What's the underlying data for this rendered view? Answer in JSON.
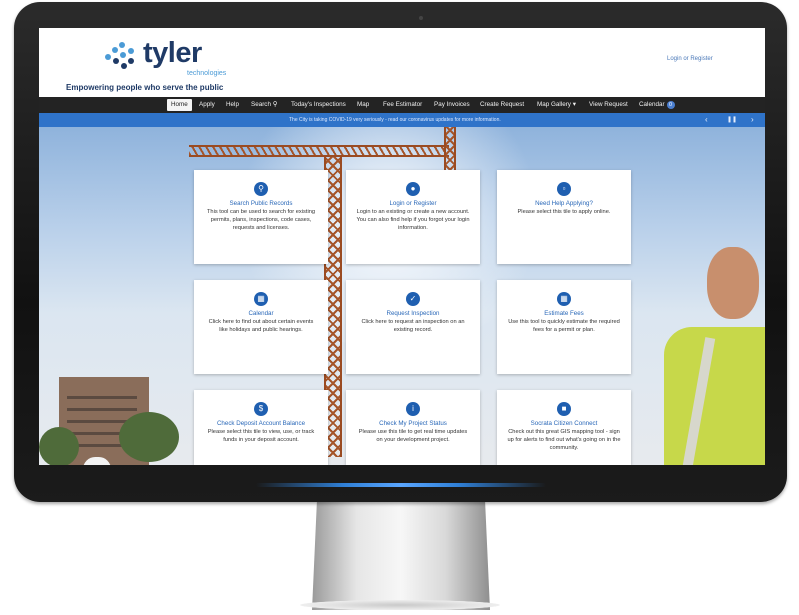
{
  "header": {
    "logo_text": "tyler",
    "logo_sub": "technologies",
    "tagline": "Empowering people who serve the public",
    "login_link": "Login or Register"
  },
  "nav": {
    "items": [
      {
        "label": "Home"
      },
      {
        "label": "Apply"
      },
      {
        "label": "Help"
      },
      {
        "label": "Search"
      },
      {
        "label": "Today's Inspections"
      },
      {
        "label": "Map"
      },
      {
        "label": "Fee Estimator"
      },
      {
        "label": "Pay Invoices"
      },
      {
        "label": "Create Request"
      },
      {
        "label": "Map Gallery"
      },
      {
        "label": "View Request"
      },
      {
        "label": "Calendar"
      }
    ],
    "search_icon": "search-icon",
    "dropdown_icon": "caret-down-icon",
    "calendar_badge": "0"
  },
  "alert": {
    "text": "The City is taking COVID-19 very seriously - read our coronavirus updates for more information.",
    "prev": "‹",
    "pause": "❚❚",
    "next": "›"
  },
  "tiles": [
    {
      "icon": "search-icon",
      "title": "Search Public Records",
      "desc": "This tool can be used to search for existing permits, plans, inspections, code cases, requests and licenses."
    },
    {
      "icon": "users-icon",
      "title": "Login or Register",
      "desc": "Login to an existing or create a new account. You can also find help if you forgot your login information."
    },
    {
      "icon": "clipboard-icon",
      "title": "Need Help Applying?",
      "desc": "Please select this tile to apply online."
    },
    {
      "icon": "calendar-icon",
      "title": "Calendar",
      "desc": "Click here to find out about certain events like holidays and public hearings."
    },
    {
      "icon": "calendar-check-icon",
      "title": "Request Inspection",
      "desc": "Click here to request an inspection on an existing record."
    },
    {
      "icon": "calculator-icon",
      "title": "Estimate Fees",
      "desc": "Use this tool to quickly estimate the required fees for a permit or plan."
    },
    {
      "icon": "dollar-icon",
      "title": "Check Deposit Account Balance",
      "desc": "Please select this tile to view, use, or track funds in your deposit account."
    },
    {
      "icon": "info-icon",
      "title": "Check My Project Status",
      "desc": "Please use this tile to get real time updates on your development project."
    },
    {
      "icon": "folder-icon",
      "title": "Socrata Citizen Connect",
      "desc": "Check out this great GIS mapping tool - sign up for alerts to find out what's going on in the community."
    }
  ],
  "colors": {
    "brand_navy": "#1f3a66",
    "brand_blue": "#4b9bd6",
    "alert_blue": "#2f73c9",
    "tile_icon": "#1f5fb0",
    "nav_bg": "#232323"
  }
}
